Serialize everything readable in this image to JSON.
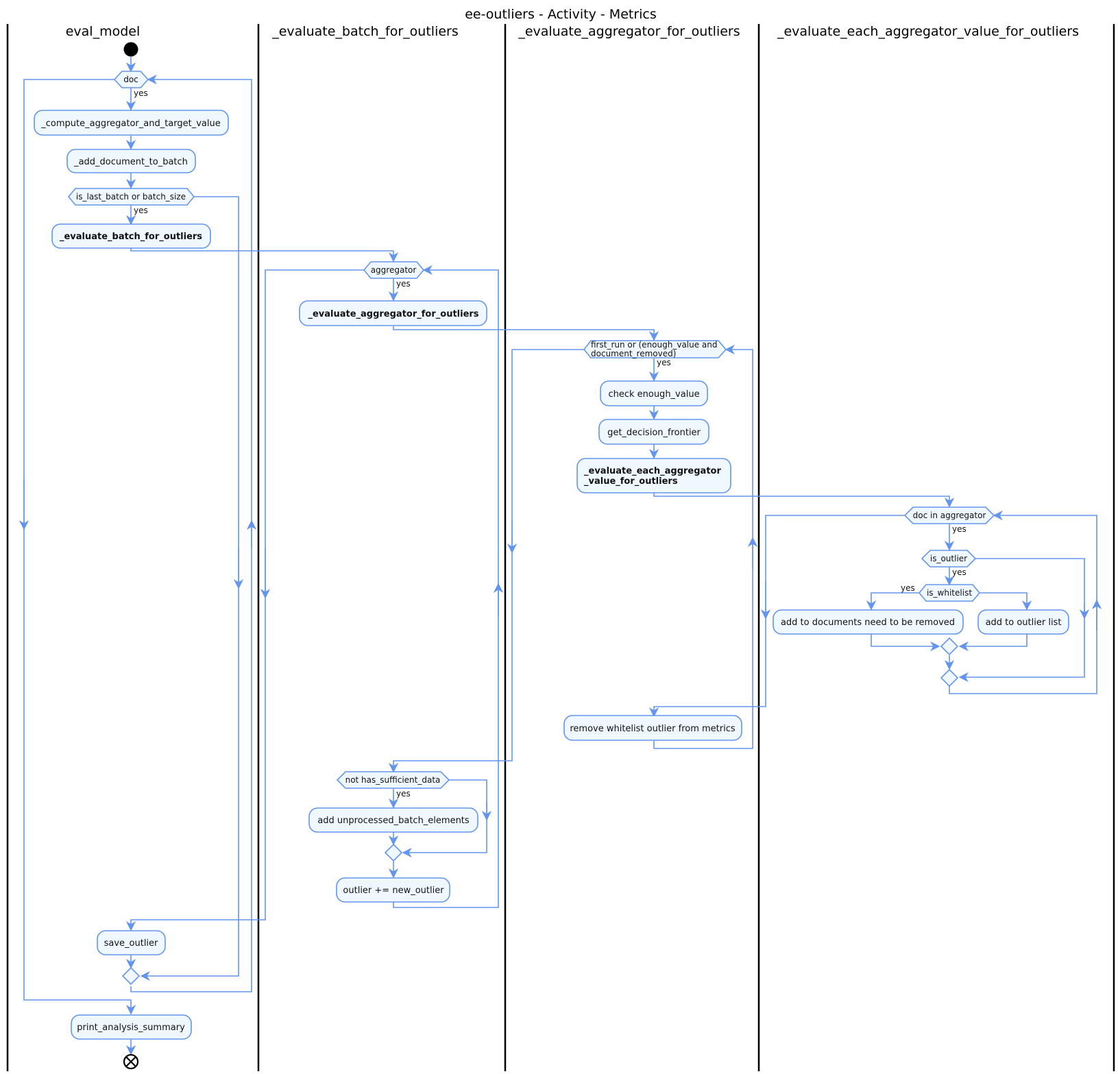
{
  "title": "ee-outliers - Activity - Metrics",
  "colors": {
    "flow": "#6495ed",
    "node_fill": "#f0f8ff",
    "lane_border": "#000000"
  },
  "lanes": [
    {
      "label": "eval_model"
    },
    {
      "label": "_evaluate_batch_for_outliers"
    },
    {
      "label": "_evaluate_aggregator_for_outliers"
    },
    {
      "label": "_evaluate_each_aggregator_value_for_outliers"
    }
  ],
  "nodes": {
    "start": {
      "type": "start"
    },
    "doc_loop": {
      "type": "decision",
      "label": "doc",
      "guard": "yes"
    },
    "compute": {
      "type": "action",
      "label": "_compute_aggregator_and_target_value"
    },
    "add_doc": {
      "type": "action",
      "label": "_add_document_to_batch"
    },
    "is_last": {
      "type": "decision",
      "label": "is_last_batch or batch_size",
      "guard": "yes"
    },
    "eval_batch_call": {
      "type": "action",
      "label": "_evaluate_batch_for_outliers",
      "bold": true
    },
    "agg_loop": {
      "type": "decision",
      "label": "aggregator",
      "guard": "yes"
    },
    "eval_agg_call": {
      "type": "action",
      "label": "_evaluate_aggregator_for_outliers",
      "bold": true
    },
    "first_run_loop": {
      "type": "decision",
      "label_line1": "first_run or (enough_value and",
      "label_line2": "document_removed)",
      "guard": "yes"
    },
    "check_enough": {
      "type": "action",
      "label": "check enough_value"
    },
    "get_frontier": {
      "type": "action",
      "label": "get_decision_frontier"
    },
    "eval_each_call": {
      "type": "action",
      "label_line1": "_evaluate_each_aggregator",
      "label_line2": "_value_for_outliers",
      "bold": true
    },
    "doc_in_agg_loop": {
      "type": "decision",
      "label": "doc in aggregator",
      "guard": "yes"
    },
    "is_outlier": {
      "type": "decision",
      "label": "is_outlier",
      "guard": "yes"
    },
    "is_whitelist": {
      "type": "decision",
      "label": "is_whitelist",
      "guard": "yes"
    },
    "add_docs_removed": {
      "type": "action",
      "label": "add to documents need to be removed"
    },
    "add_outlier_list": {
      "type": "action",
      "label": "add to outlier list"
    },
    "remove_whitelist": {
      "type": "action",
      "label": "remove whitelist outlier from metrics"
    },
    "not_sufficient": {
      "type": "decision",
      "label": "not has_sufficient_data",
      "guard": "yes"
    },
    "add_unprocessed": {
      "type": "action",
      "label": "add unprocessed_batch_elements"
    },
    "outlier_plus": {
      "type": "action",
      "label": "outlier += new_outlier"
    },
    "save_outlier": {
      "type": "action",
      "label": "save_outlier"
    },
    "print_summary": {
      "type": "action",
      "label": "print_analysis_summary"
    },
    "end": {
      "type": "end"
    }
  }
}
